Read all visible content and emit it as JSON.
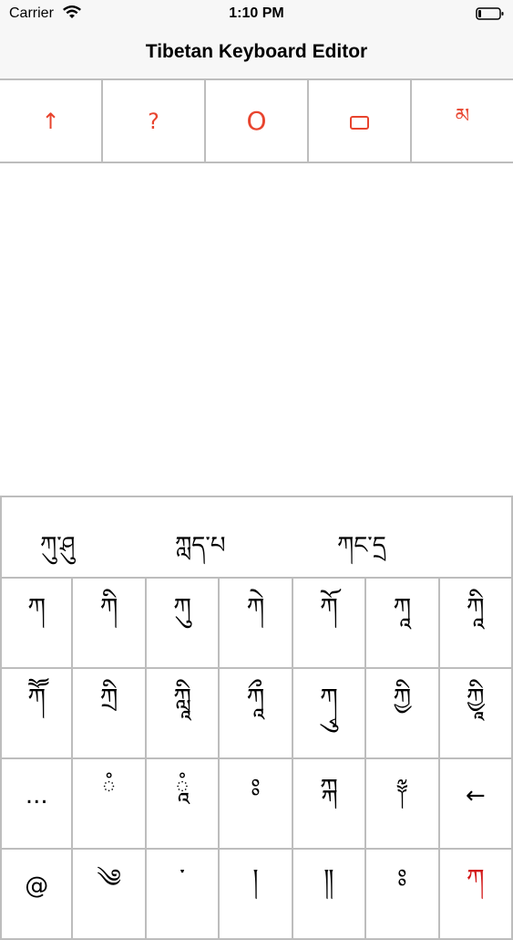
{
  "status_bar": {
    "carrier": "Carrier",
    "time": "1:10 PM",
    "wifi_icon": "wifi-icon",
    "battery_icon": "battery-icon"
  },
  "nav": {
    "title": "Tibetan Keyboard Editor"
  },
  "toolbar": {
    "accent_color": "#e8442e",
    "buttons": [
      {
        "label": "↑",
        "icon": "arrow-up-icon"
      },
      {
        "label": "?",
        "icon": "question-icon"
      },
      {
        "label": "O",
        "icon": "circle-icon"
      },
      {
        "label": "",
        "icon": "rectangle-icon"
      },
      {
        "label": "མ",
        "icon": "tibetan-ma-icon"
      }
    ]
  },
  "keyboard": {
    "suggestions": [
      "ཀུ་ཤུ",
      "ཀླད་པ",
      "ཀང་དྲ"
    ],
    "rows": [
      [
        "ཀ",
        "ཀི",
        "ཀུ",
        "ཀེ",
        "ཀོ",
        "ཀཱ",
        "ཀཱི"
      ],
      [
        "ཀཽ",
        "ཀྲི",
        "ཀླཱི",
        "ཀཱྀ",
        "ཀྭུ",
        "ཀྱི",
        "ཀྱཱི"
      ],
      [
        "...",
        "ཾ",
        "ཱཾ",
        "ཿ",
        "ཀྐ",
        "༈",
        "←"
      ],
      [
        "@",
        "༄",
        "་",
        "།",
        "༎",
        "ཿ",
        "ཀ"
      ]
    ],
    "highlight_color": "#d31a1a"
  }
}
